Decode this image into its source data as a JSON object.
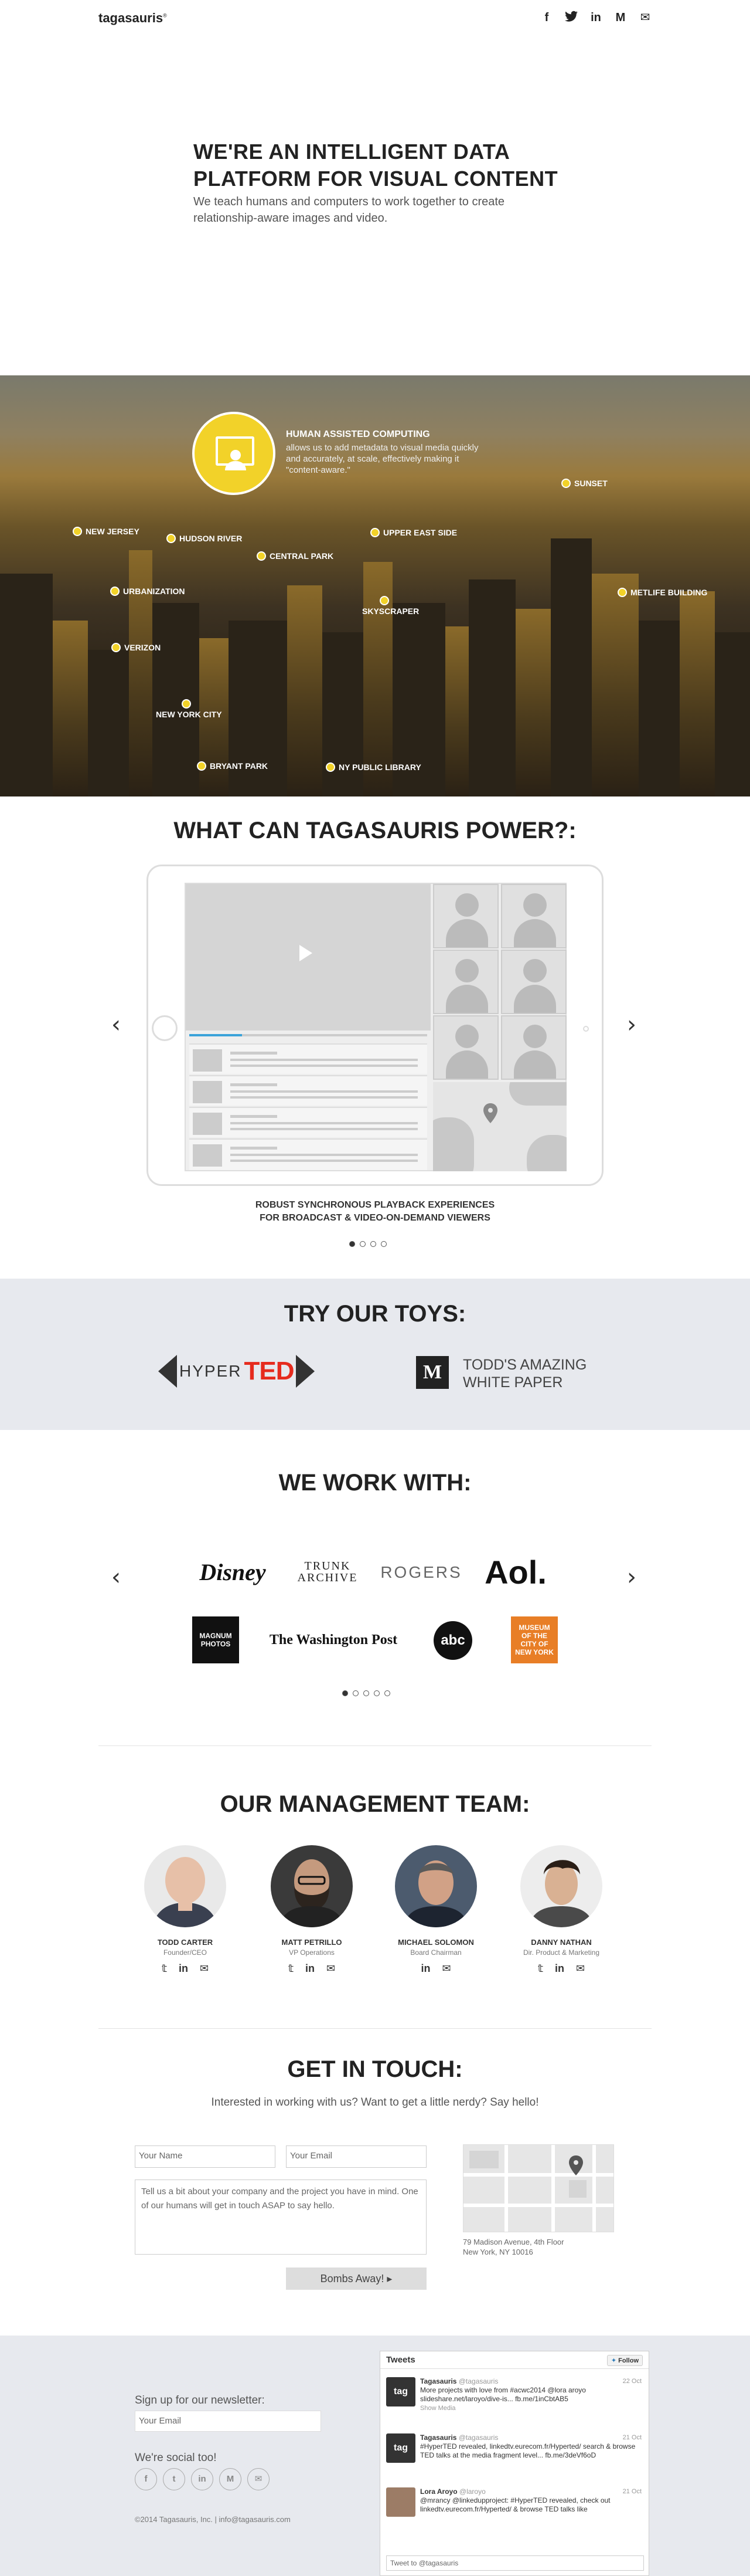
{
  "header": {
    "logo": "tagasauris",
    "logo_mark": "®",
    "social": [
      {
        "icon": "facebook-icon",
        "glyph": "f"
      },
      {
        "icon": "twitter-icon",
        "glyph": "t"
      },
      {
        "icon": "linkedin-icon",
        "glyph": "in"
      },
      {
        "icon": "medium-icon",
        "glyph": "M"
      },
      {
        "icon": "mail-icon",
        "glyph": "✉"
      }
    ]
  },
  "hero": {
    "title": "WE'RE AN INTELLIGENT DATA PLATFORM FOR VISUAL CONTENT",
    "subtitle": "We teach humans and computers to work together to create relationship-aware images and video."
  },
  "city": {
    "feature_title": "HUMAN ASSISTED COMPUTING",
    "feature_text": "allows us to add metadata to visual media quickly and accurately, at scale, effectively making it \"content-aware.\"",
    "pins": [
      "NEW JERSEY",
      "HUDSON RIVER",
      "CENTRAL PARK",
      "UPPER EAST SIDE",
      "SUNSET",
      "URBANIZATION",
      "SKYSCRAPER",
      "METLIFE BUILDING",
      "VERIZON",
      "NEW YORK CITY",
      "BRYANT PARK",
      "NY PUBLIC LIBRARY"
    ]
  },
  "power": {
    "title": "WHAT CAN TAGASAURIS POWER?:",
    "caption_line1": "ROBUST SYNCHRONOUS PLAYBACK EXPERIENCES",
    "caption_line2": "FOR BROADCAST & VIDEO-ON-DEMAND VIEWERS",
    "prev": "‹",
    "next": "›",
    "slides": 4,
    "active_slide": 1
  },
  "toys": {
    "title": "TRY OUR TOYS:",
    "hyperted_hyper": "HYPER",
    "hyperted_ted": "TED",
    "todd_logo": "M",
    "todd_line1": "TODD'S AMAZING",
    "todd_line2": "WHITE PAPER"
  },
  "partners": {
    "title": "WE WORK WITH:",
    "logos": [
      "Disney",
      "TRUNK ARCHIVE",
      "ROGERS",
      "Aol.",
      "MAGNUM PHOTOS",
      "The Washington Post",
      "abc",
      "MUSEUM OF THE CITY OF NEW YORK"
    ],
    "slides": 5,
    "active_slide": 1,
    "prev": "‹",
    "next": "›"
  },
  "team": {
    "title": "OUR MANAGEMENT TEAM:",
    "members": [
      {
        "name": "TODD CARTER",
        "role": "Founder/CEO"
      },
      {
        "name": "MATT PETRILLO",
        "role": "VP Operations"
      },
      {
        "name": "MICHAEL SOLOMON",
        "role": "Board Chairman"
      },
      {
        "name": "DANNY NATHAN",
        "role": "Dir. Product & Marketing"
      }
    ]
  },
  "contact": {
    "title": "GET IN TOUCH:",
    "subtitle": "Interested in working with us? Want to get a little nerdy? Say hello!",
    "name_placeholder": "Your Name",
    "email_placeholder": "Your Email",
    "message_placeholder": "Tell us a bit about your company and the project you have in mind. One of our humans will get in touch ASAP to say hello.",
    "submit": "Bombs Away!",
    "address_line1": "79 Madison Avenue, 4th Floor",
    "address_line2": "New York, NY 10016"
  },
  "footer": {
    "newsletter_label": "Sign up for our newsletter:",
    "newsletter_placeholder": "Your Email",
    "social_label": "We're social too!",
    "copyright": "©2014 Tagasauris, Inc. | info@tagasauris.com",
    "tweets_title": "Tweets",
    "follow_label": "Follow",
    "tweet_box": "Tweet to @tagasauris",
    "tweets": [
      {
        "avatar": "tag",
        "name": "Tagasauris",
        "handle": "@tagasauris",
        "date": "22 Oct",
        "text": "More projects with love from #acwc2014 @lora aroyo slideshare.net/laroyo/dive-is... fb.me/1inCbtAB5",
        "extra": "Show Media"
      },
      {
        "avatar": "tag",
        "name": "Tagasauris",
        "handle": "@tagasauris",
        "date": "21 Oct",
        "text": "#HyperTED revealed, linkedtv.eurecom.fr/Hyperted/ search & browse TED talks at the media fragment level... fb.me/3deVf6oD",
        "extra": ""
      },
      {
        "avatar": "",
        "name": "Lora Aroyo",
        "handle": "@laroyo",
        "date": "21 Oct",
        "text": "@mrancy @linkedupproject: #HyperTED revealed, check out linkedtv.eurecom.fr/Hyperted/ & browse TED talks like",
        "extra": ""
      }
    ]
  },
  "colors": {
    "accent_yellow": "#f2d229",
    "ted_red": "#e62b1e",
    "band_gray": "#e7e9ee",
    "progress_blue": "#3ba3d9"
  }
}
